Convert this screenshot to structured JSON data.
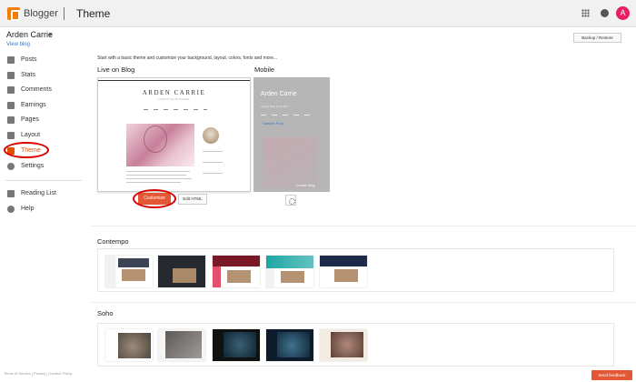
{
  "header": {
    "brand": "Blogger",
    "page_title": "Theme",
    "avatar_letter": "A"
  },
  "sidebar": {
    "blog_name": "Arden Carrie",
    "view_blog": "View blog",
    "items": [
      {
        "label": "Posts",
        "icon": "posts-icon"
      },
      {
        "label": "Stats",
        "icon": "stats-icon"
      },
      {
        "label": "Comments",
        "icon": "comments-icon"
      },
      {
        "label": "Earnings",
        "icon": "earnings-icon"
      },
      {
        "label": "Pages",
        "icon": "pages-icon"
      },
      {
        "label": "Layout",
        "icon": "layout-icon"
      },
      {
        "label": "Theme",
        "icon": "theme-icon",
        "active": true
      },
      {
        "label": "Settings",
        "icon": "settings-icon"
      }
    ],
    "secondary_items": [
      {
        "label": "Reading List",
        "icon": "reading-list-icon"
      },
      {
        "label": "Help",
        "icon": "help-icon"
      }
    ],
    "footer": "Terms of Service  |  Privacy  |  Content Policy"
  },
  "main": {
    "backup_button": "Backup / Restore",
    "intro": "Start with a basic theme and customize your background, layout, colors, fonts and more...",
    "live_label": "Live on Blog",
    "mobile_label": "Mobile",
    "live_preview": {
      "title": "ARDEN CARRIE",
      "subtitle": "LIFESTYLE BLOGGER"
    },
    "mobile_preview": {
      "title": "Arden Carrie",
      "subtitle": "Lifestyle Blog | by the Team",
      "link": "Sample Post",
      "overlay": "Cruise Vlog"
    },
    "customize_button": "Customize",
    "edit_html_button": "Edit HTML",
    "contempo_label": "Contempo",
    "soho_label": "Soho"
  },
  "feedback_button": "Send feedback",
  "colors": {
    "accent": "#e45734",
    "highlight_circle": "#d90000",
    "link": "#3a76c4"
  }
}
